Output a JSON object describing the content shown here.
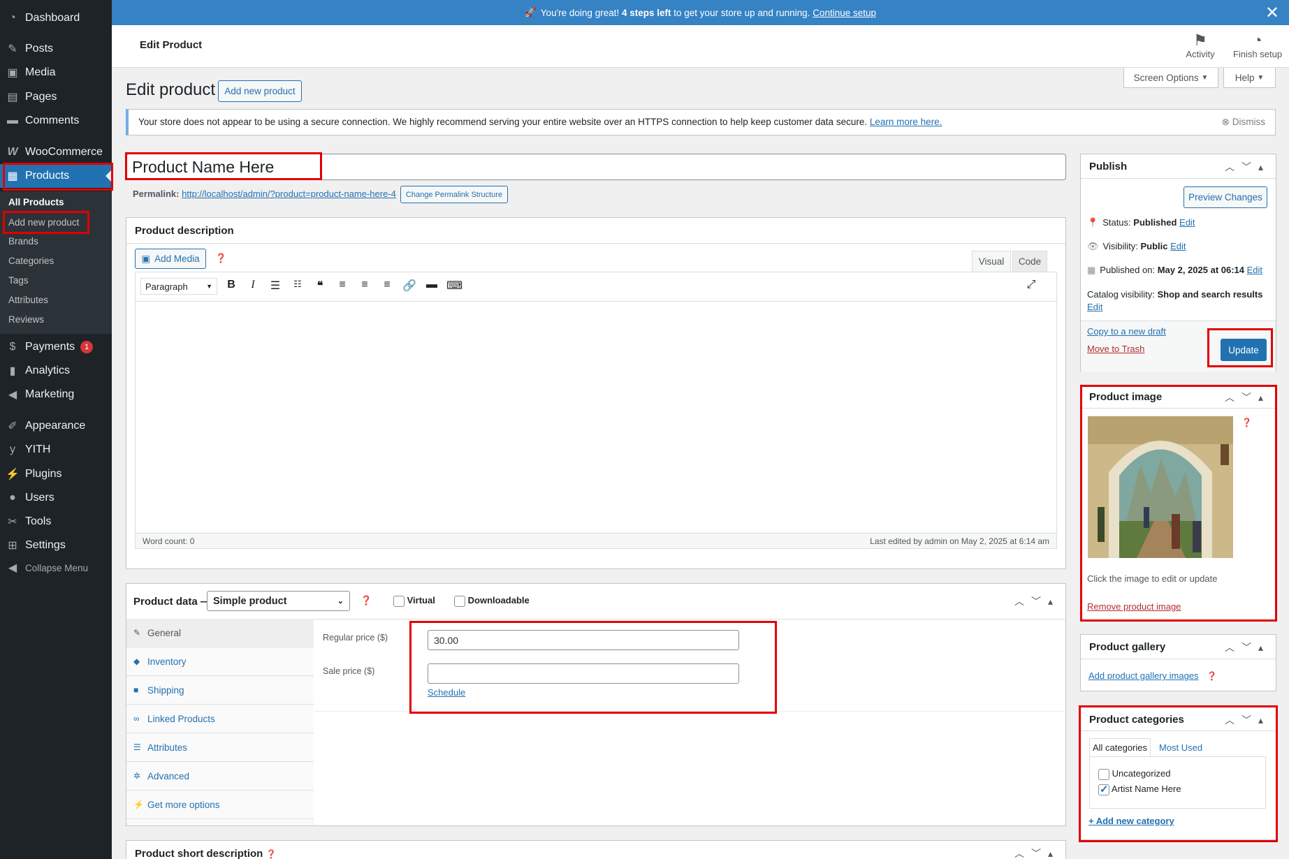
{
  "sidebar": {
    "dashboard": "Dashboard",
    "posts": "Posts",
    "media": "Media",
    "pages": "Pages",
    "comments": "Comments",
    "woocommerce": "WooCommerce",
    "products": "Products",
    "products_sub": [
      "All Products",
      "Add new product",
      "Brands",
      "Categories",
      "Tags",
      "Attributes",
      "Reviews"
    ],
    "payments": "Payments",
    "payments_badge": "1",
    "analytics": "Analytics",
    "marketing": "Marketing",
    "appearance": "Appearance",
    "yith": "YITH",
    "plugins": "Plugins",
    "users": "Users",
    "tools": "Tools",
    "settings": "Settings",
    "collapse": "Collapse Menu"
  },
  "topbar": {
    "emoji": "🚀",
    "text_before": "You're doing great!",
    "bold": "4 steps left",
    "text_after": "to get your store up and running.",
    "link": "Continue setup"
  },
  "header": {
    "title": "Edit Product",
    "activity": "Activity",
    "finish_setup": "Finish setup"
  },
  "page": {
    "heading": "Edit product",
    "add_new": "Add new product",
    "screen_options": "Screen Options",
    "help": "Help"
  },
  "notice": {
    "text": "Your store does not appear to be using a secure connection. We highly recommend serving your entire website over an HTTPS connection to help keep customer data secure.",
    "link": "Learn more here.",
    "dismiss": "Dismiss"
  },
  "product": {
    "title": "Product Name Here",
    "permalink_label": "Permalink:",
    "permalink_url": "http://localhost/admin/?product=product-name-here-4",
    "change_permalink": "Change Permalink Structure"
  },
  "description": {
    "title": "Product description",
    "add_media": "Add Media",
    "tab_visual": "Visual",
    "tab_code": "Code",
    "format": "Paragraph",
    "word_count": "Word count: 0",
    "last_edited": "Last edited by admin on May 2, 2025 at 6:14 am"
  },
  "product_data": {
    "title": "Product data —",
    "type": "Simple product",
    "virtual": "Virtual",
    "downloadable": "Downloadable",
    "tabs": [
      "General",
      "Inventory",
      "Shipping",
      "Linked Products",
      "Attributes",
      "Advanced",
      "Get more options"
    ],
    "regular_price_label": "Regular price ($)",
    "regular_price": "30.00",
    "sale_price_label": "Sale price ($)",
    "sale_price": "",
    "schedule": "Schedule"
  },
  "short_description": {
    "title": "Product short description"
  },
  "publish": {
    "title": "Publish",
    "preview": "Preview Changes",
    "status_label": "Status:",
    "status": "Published",
    "visibility_label": "Visibility:",
    "visibility": "Public",
    "published_label": "Published on:",
    "published": "May 2, 2025 at 06:14",
    "catalog_label": "Catalog visibility:",
    "catalog": "Shop and search results",
    "edit": "Edit",
    "copy_draft": "Copy to a new draft",
    "trash": "Move to Trash",
    "update": "Update"
  },
  "product_image": {
    "title": "Product image",
    "hint": "Click the image to edit or update",
    "remove": "Remove product image"
  },
  "gallery": {
    "title": "Product gallery",
    "add": "Add product gallery images"
  },
  "categories": {
    "title": "Product categories",
    "tab_all": "All categories",
    "tab_used": "Most Used",
    "items": [
      {
        "label": "Uncategorized",
        "checked": false
      },
      {
        "label": "Artist Name Here",
        "checked": true
      }
    ],
    "add_new": "+ Add new category"
  }
}
